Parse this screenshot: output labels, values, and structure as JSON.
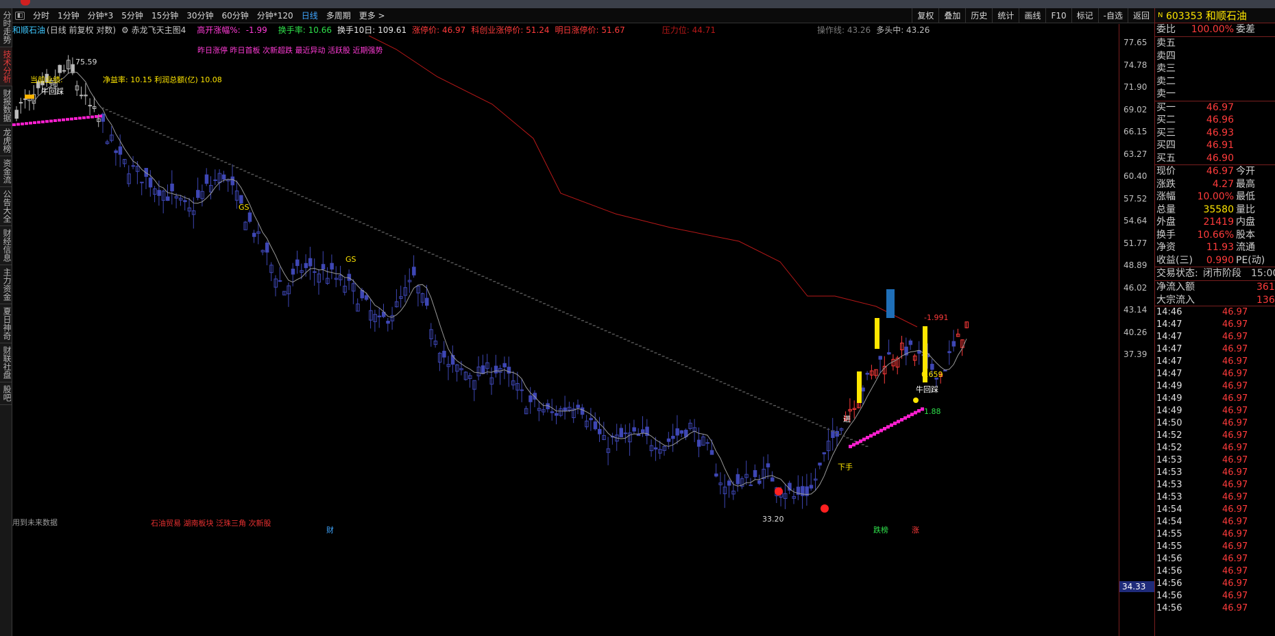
{
  "sidebar": [
    "分时走势",
    "技术分析",
    "财报数据",
    "龙虎榜",
    "资金流",
    "公告大全",
    "财经信息",
    "主力资金",
    "夏日神奇",
    "财联社盘",
    "股吧"
  ],
  "toolbar": {
    "periods": [
      "分时",
      "1分钟",
      "分钟*3",
      "5分钟",
      "15分钟",
      "30分钟",
      "60分钟",
      "分钟*120",
      "日线",
      "多周期",
      "更多 >"
    ],
    "active_period": "日线",
    "right": [
      "复权",
      "叠加",
      "历史",
      "统计",
      "画线",
      "F10",
      "标记",
      "-自选",
      "返回"
    ]
  },
  "info": {
    "stock": "和顺石油",
    "mode": "(日线 前复权 对数)",
    "indicator": "赤龙飞天主图4",
    "gap_label": "高开涨幅%:",
    "gap_value": "-1.99",
    "turnover": "换手率: 10.66",
    "turnover10": "换手10日: 109.61",
    "limit_up": "涨停价: 46.97",
    "kechuang": "科创业涨停价: 51.24",
    "tomorrow": "明日涨停价: 51.67",
    "pressure": "压力位: 44.71",
    "opline": "操作线: 43.26",
    "long": "多头中: 43.26"
  },
  "chart_labels": {
    "tags": "昨日涨停 昨日首板 次新超跌 最近异动 活跃股 近期强势",
    "profit": "当前业绩:",
    "pe": "净益率: 10.15 利润总额(亿) 10.08",
    "high": "75.59",
    "low": "33.20",
    "bull1": "牛回踩",
    "bull2": "牛回踩",
    "gs1": "GS",
    "gs2": "GS",
    "future": "用到未来数据",
    "concepts": "石油贸易 湖南板块 泛珠三角 次新股",
    "cai": "财",
    "diebang": "跌榜",
    "zhang": "涨",
    "xiashou": "下手",
    "v1": "-1.991",
    "v2": "1.88",
    "v3": "0.659",
    "jin": "进"
  },
  "yaxis": [
    "77.65",
    "74.78",
    "71.90",
    "69.02",
    "66.15",
    "63.27",
    "60.40",
    "57.52",
    "54.64",
    "51.77",
    "48.89",
    "46.02",
    "43.14",
    "40.26",
    "37.39"
  ],
  "ycurrent": "34.33",
  "panel": {
    "code": "603353",
    "name": "和顺石油",
    "weibi_label": "委比",
    "weibi": "100.00%",
    "weicha_label": "委差",
    "sells": [
      [
        "卖五",
        ""
      ],
      [
        "卖四",
        ""
      ],
      [
        "卖三",
        ""
      ],
      [
        "卖二",
        ""
      ],
      [
        "卖一",
        ""
      ]
    ],
    "buys": [
      [
        "买一",
        "46.97"
      ],
      [
        "买二",
        "46.96"
      ],
      [
        "买三",
        "46.93"
      ],
      [
        "买四",
        "46.91"
      ],
      [
        "买五",
        "46.90"
      ]
    ],
    "stats": [
      [
        "现价",
        "46.97",
        "今开"
      ],
      [
        "涨跌",
        "4.27",
        "最高"
      ],
      [
        "涨幅",
        "10.00%",
        "最低"
      ],
      [
        "总量",
        "35580",
        "量比"
      ],
      [
        "外盘",
        "21419",
        "内盘"
      ],
      [
        "换手",
        "10.66%",
        "股本"
      ],
      [
        "净资",
        "11.93",
        "流通"
      ],
      [
        "收益(三)",
        "0.990",
        "PE(动)"
      ]
    ],
    "trade_state_label": "交易状态:",
    "trade_state": "闭市阶段",
    "trade_time": "15:00",
    "netflow_label": "净流入额",
    "netflow": "361",
    "block_label": "大宗流入",
    "block": "136",
    "ticks": [
      [
        "14:46",
        "46.97"
      ],
      [
        "14:47",
        "46.97"
      ],
      [
        "14:47",
        "46.97"
      ],
      [
        "14:47",
        "46.97"
      ],
      [
        "14:47",
        "46.97"
      ],
      [
        "14:47",
        "46.97"
      ],
      [
        "14:49",
        "46.97"
      ],
      [
        "14:49",
        "46.97"
      ],
      [
        "14:49",
        "46.97"
      ],
      [
        "14:50",
        "46.97"
      ],
      [
        "14:52",
        "46.97"
      ],
      [
        "14:52",
        "46.97"
      ],
      [
        "14:53",
        "46.97"
      ],
      [
        "14:53",
        "46.97"
      ],
      [
        "14:53",
        "46.97"
      ],
      [
        "14:53",
        "46.97"
      ],
      [
        "14:54",
        "46.97"
      ],
      [
        "14:54",
        "46.97"
      ],
      [
        "14:55",
        "46.97"
      ],
      [
        "14:55",
        "46.97"
      ],
      [
        "14:56",
        "46.97"
      ],
      [
        "14:56",
        "46.97"
      ],
      [
        "14:56",
        "46.97"
      ],
      [
        "14:56",
        "46.97"
      ],
      [
        "14:56",
        "46.97"
      ]
    ]
  },
  "colors": {
    "up": "#ff3b3b",
    "down": "#4a52c8",
    "ma": "#bfbfbf",
    "pressure": "#b81818",
    "magenta": "#ff1fd0",
    "yellow": "#ffe600"
  }
}
